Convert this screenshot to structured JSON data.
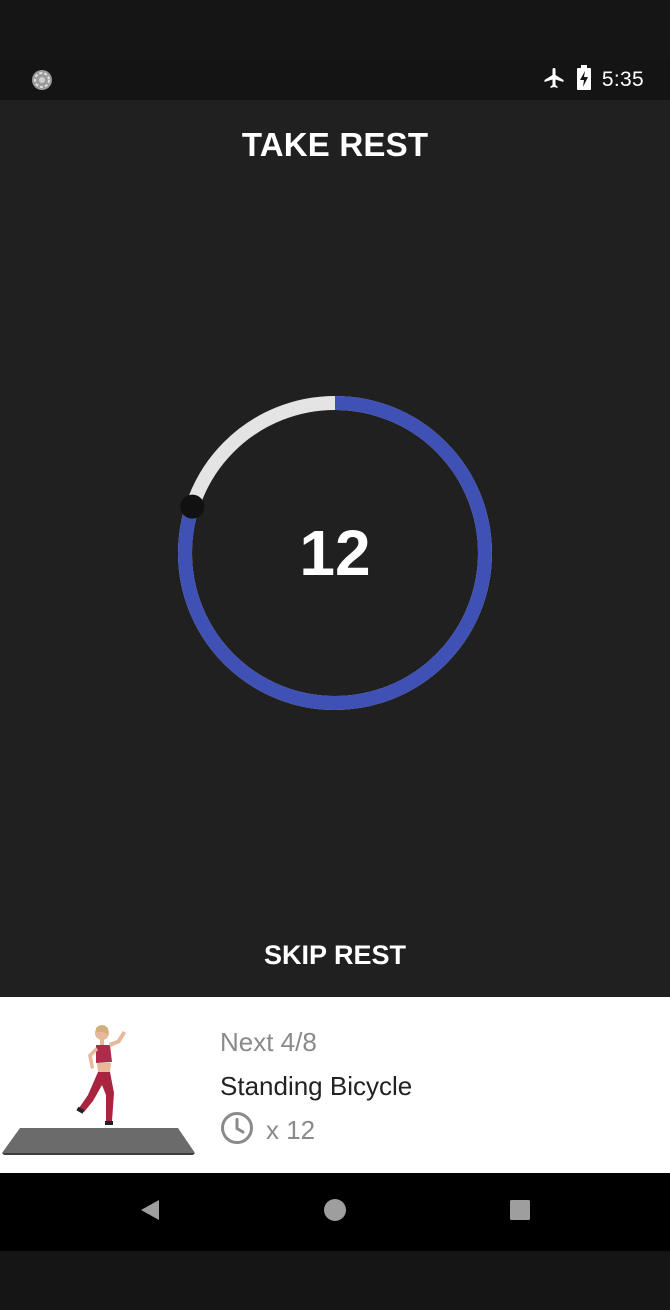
{
  "status_bar": {
    "time": "5:35",
    "icons": [
      "sync-icon",
      "airplane-mode-icon",
      "battery-charging-icon"
    ]
  },
  "header": {
    "title": "TAKE REST"
  },
  "timer": {
    "value": "12",
    "progress_fraction": 0.8,
    "colors": {
      "progress": "#3f51b5",
      "track": "#e4e4e4",
      "knob": "#111111"
    }
  },
  "actions": {
    "skip_label": "SKIP REST"
  },
  "next_exercise": {
    "progress_label": "Next 4/8",
    "name": "Standing Bicycle",
    "reps": "x 12",
    "icon": "clock-icon"
  },
  "nav": {
    "icons": [
      "back-icon",
      "home-icon",
      "recents-icon"
    ]
  },
  "colors": {
    "background": "#202020",
    "accent": "#3f51b5",
    "card": "#ffffff"
  }
}
